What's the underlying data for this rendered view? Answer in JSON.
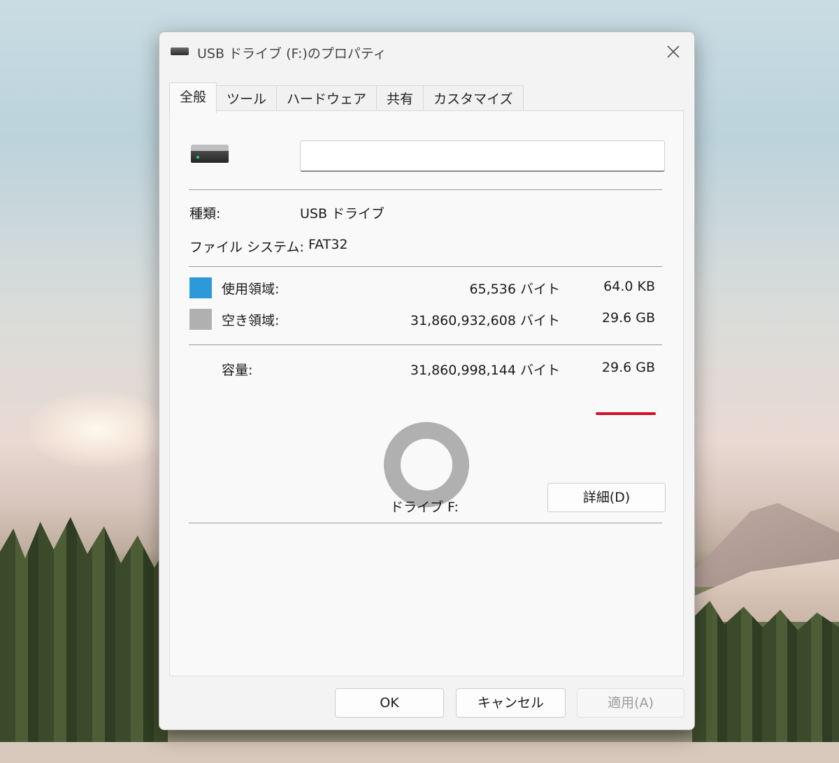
{
  "window": {
    "title": "USB ドライブ (F:)のプロパティ"
  },
  "tabs": [
    {
      "label": "全般",
      "active": true
    },
    {
      "label": "ツール",
      "active": false
    },
    {
      "label": "ハードウェア",
      "active": false
    },
    {
      "label": "共有",
      "active": false
    },
    {
      "label": "カスタマイズ",
      "active": false
    }
  ],
  "general": {
    "name_value": "",
    "type_label": "種類:",
    "type_value": "USB ドライブ",
    "fs_label": "ファイル システム:",
    "fs_value": "FAT32",
    "used": {
      "label": "使用領域:",
      "bytes": "65,536 バイト",
      "size": "64.0 KB",
      "color": "#2c9ad8"
    },
    "free": {
      "label": "空き領域:",
      "bytes": "31,860,932,608 バイト",
      "size": "29.6 GB",
      "color": "#b0b0b0"
    },
    "capacity": {
      "label": "容量:",
      "bytes": "31,860,998,144 バイト",
      "size": "29.6 GB",
      "highlight_color": "#d1122a"
    },
    "usage_fraction": 2e-06,
    "drive_label": "ドライブ F:",
    "details_button": "詳細(D)"
  },
  "footer": {
    "ok": "OK",
    "cancel": "キャンセル",
    "apply": "適用(A)"
  }
}
